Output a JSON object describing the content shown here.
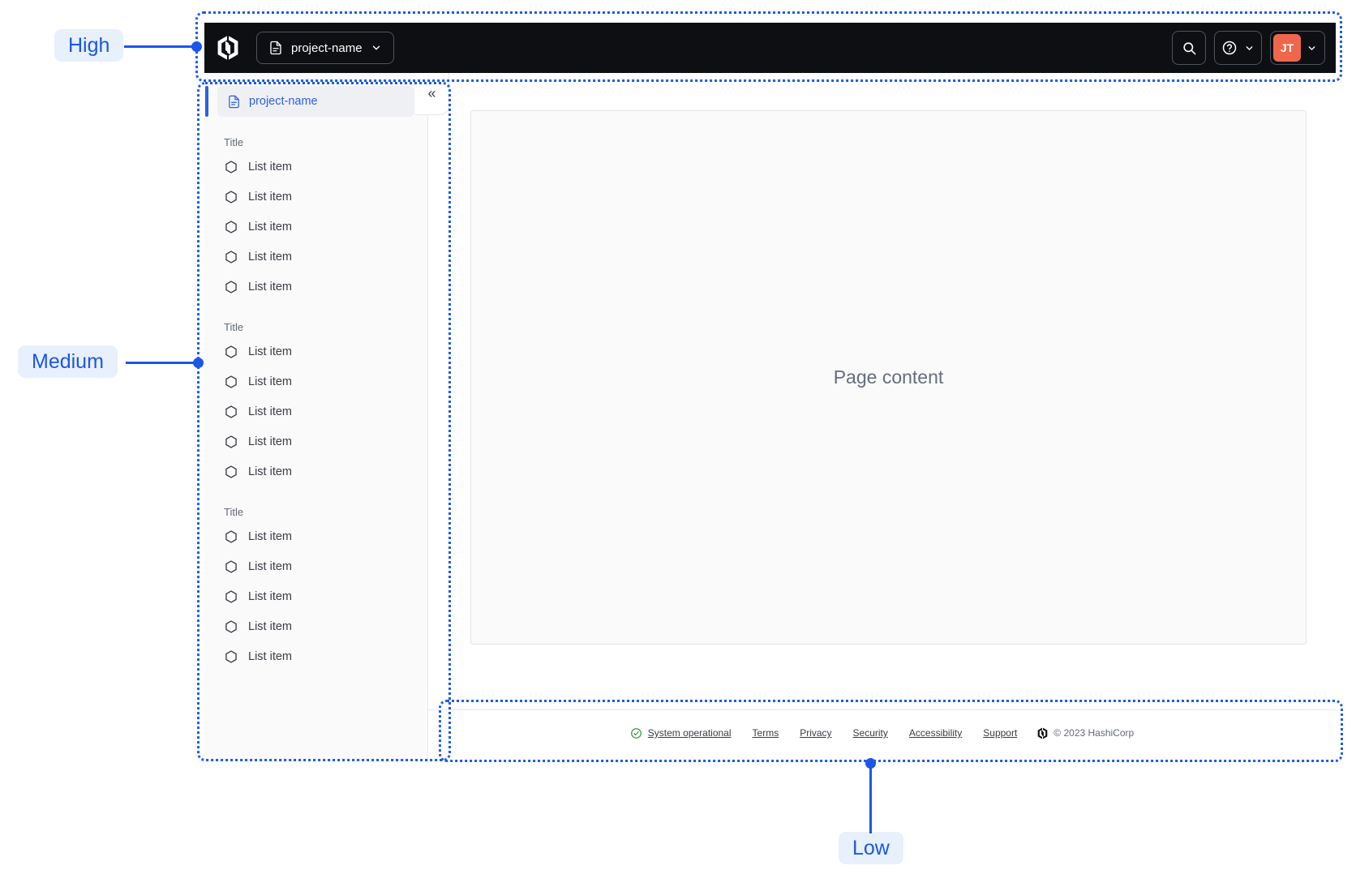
{
  "colors": {
    "annotation_blue": "#1C5BE8",
    "annotation_label_bg": "#E8F0FD",
    "navbar_bg": "#0D0F13",
    "avatar_bg": "#F0664C",
    "sidebar_active_blue": "#2D5FE8",
    "status_green": "#2E9E44"
  },
  "annotations": {
    "high": "High",
    "medium": "Medium",
    "low": "Low"
  },
  "navbar": {
    "project_switcher_label": "project-name",
    "avatar_initials": "JT"
  },
  "sidebar": {
    "header_label": "project-name",
    "sections": [
      {
        "title": "Title",
        "items": [
          "List item",
          "List item",
          "List item",
          "List item",
          "List item"
        ]
      },
      {
        "title": "Title",
        "items": [
          "List item",
          "List item",
          "List item",
          "List item",
          "List item"
        ]
      },
      {
        "title": "Title",
        "items": [
          "List item",
          "List item",
          "List item",
          "List item",
          "List item"
        ]
      }
    ]
  },
  "icons": {
    "collapse_glyph": "«"
  },
  "main": {
    "placeholder": "Page content"
  },
  "footer": {
    "status_label": "System operational",
    "links": [
      "Terms",
      "Privacy",
      "Security",
      "Accessibility",
      "Support"
    ],
    "copyright": "© 2023 HashiCorp"
  }
}
